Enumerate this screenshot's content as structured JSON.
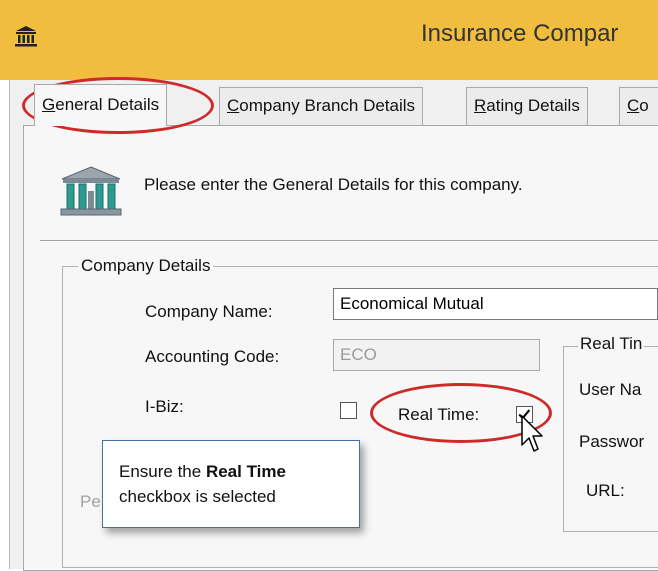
{
  "window": {
    "title": "Insurance Compar",
    "icon": "bank-building-icon",
    "accent_color": "#f0bd3f"
  },
  "tabs": [
    {
      "label": "General Details",
      "underline": "G",
      "rest": "eneral Details",
      "active": true
    },
    {
      "label": "Company Branch Details",
      "underline": "C",
      "rest": "ompany Branch Details",
      "active": false
    },
    {
      "label": "Rating Details",
      "underline": "R",
      "rest": "ating Details",
      "active": false
    },
    {
      "label": "Co",
      "underline": "C",
      "rest": "o",
      "active": false
    }
  ],
  "header": {
    "text": "Please enter the General Details for this company.",
    "icon": "bank-building-icon"
  },
  "company_details": {
    "group_title": "Company Details",
    "company_name_label": "Company Name:",
    "company_name_value": "Economical Mutual",
    "accounting_code_label": "Accounting Code:",
    "accounting_code_value": "ECO",
    "ibiz_label": "I-Biz:",
    "ibiz_checked": false,
    "real_time_label": "Real Time:",
    "real_time_checked": true,
    "partial_label": "Pe"
  },
  "real_time_group": {
    "title": "Real Tin",
    "user_name_label": "User Na",
    "password_label": "Passwor",
    "url_label": "URL:"
  },
  "callout": {
    "prefix": "Ensure the ",
    "emphasis": "Real Time",
    "suffix": "checkbox is selected"
  },
  "annotation_color": "#cf2a2a"
}
